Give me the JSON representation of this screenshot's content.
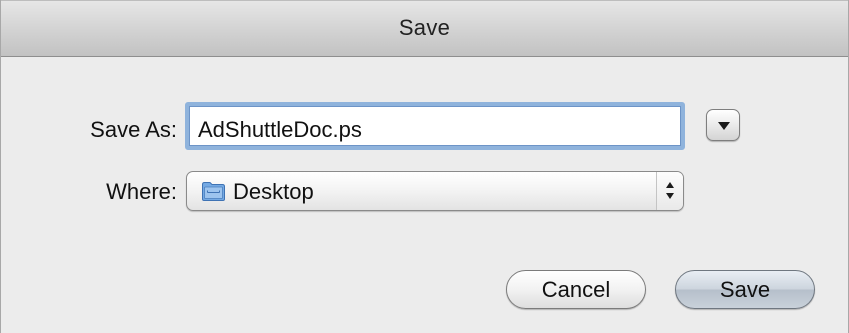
{
  "window": {
    "title": "Save"
  },
  "form": {
    "save_as_label": "Save As:",
    "file_name": "AdShuttleDoc.ps",
    "where_label": "Where:",
    "where_value": "Desktop",
    "where_icon": "folder-icon",
    "expand_icon": "disclosure-triangle-icon"
  },
  "buttons": {
    "cancel_label": "Cancel",
    "save_label": "Save"
  },
  "colors": {
    "focus_ring": "#8fb3dc",
    "default_button": "#b6c0cb",
    "folder": "#5f97d6"
  }
}
